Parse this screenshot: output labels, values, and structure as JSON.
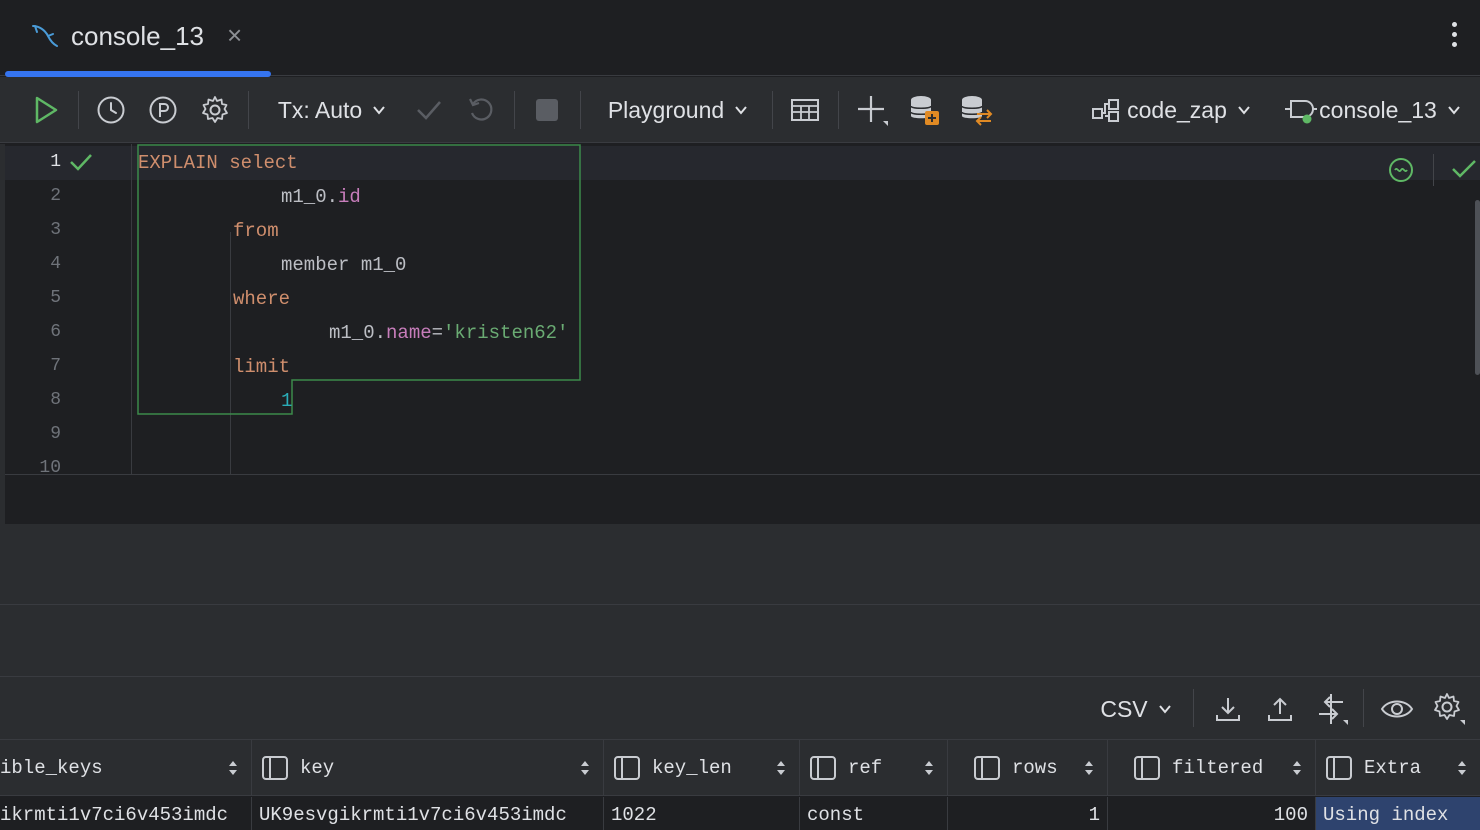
{
  "tab": {
    "title": "console_13",
    "close": "×"
  },
  "toolbar": {
    "tx_label": "Tx: Auto",
    "playground_label": "Playground",
    "schema_label": "code_zap",
    "session_label": "console_13"
  },
  "editor": {
    "line_numbers": [
      "1",
      "2",
      "3",
      "4",
      "5",
      "6",
      "7",
      "8",
      "9",
      "10"
    ],
    "lines": {
      "l1_kw1": "EXPLAIN",
      "l1_kw2": "select",
      "l2_alias": "m1_0",
      "l2_dot": ".",
      "l2_field": "id",
      "l3_kw": "from",
      "l4_text": "member m1_0",
      "l5_kw": "where",
      "l6_alias": "m1_0",
      "l6_dot": ".",
      "l6_field": "name",
      "l6_eq": "=",
      "l6_str": "'kristen62'",
      "l7_kw": "limit",
      "l8_num": "1"
    }
  },
  "results_toolbar": {
    "format_label": "CSV"
  },
  "results": {
    "columns": [
      "ible_keys",
      "key",
      "key_len",
      "ref",
      "rows",
      "filtered",
      "Extra"
    ],
    "row": [
      "ikrmti1v7ci6v453imdc",
      "UK9esvgikrmti1v7ci6v453imdc",
      "1022",
      "const",
      "1",
      "100",
      "Using index"
    ]
  },
  "colors": {
    "accent": "#3574f0",
    "success": "#5fb865",
    "keyword": "#cf8e6d",
    "string": "#6aab73",
    "field": "#c77dbb",
    "number": "#2aacb8"
  }
}
